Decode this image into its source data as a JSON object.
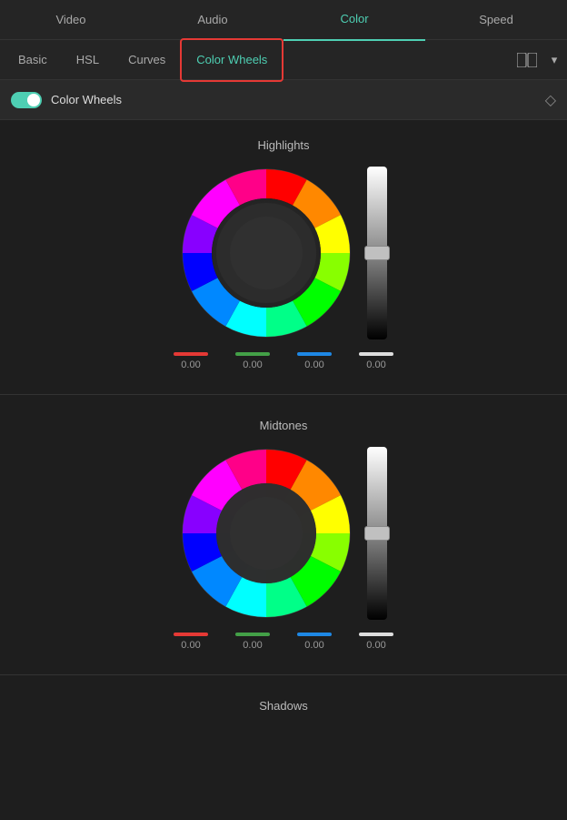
{
  "topTabs": {
    "tabs": [
      {
        "label": "Video",
        "active": false
      },
      {
        "label": "Audio",
        "active": false
      },
      {
        "label": "Color",
        "active": true
      },
      {
        "label": "Speed",
        "active": false
      }
    ]
  },
  "subTabs": {
    "tabs": [
      {
        "label": "Basic",
        "active": false
      },
      {
        "label": "HSL",
        "active": false
      },
      {
        "label": "Curves",
        "active": false
      },
      {
        "label": "Color Wheels",
        "active": true
      }
    ]
  },
  "sectionHeader": {
    "title": "Color Wheels",
    "toggleOn": true
  },
  "highlights": {
    "label": "Highlights",
    "red": "0.00",
    "green": "0.00",
    "blue": "0.00",
    "white": "0.00"
  },
  "midtones": {
    "label": "Midtones",
    "red": "0.00",
    "green": "0.00",
    "blue": "0.00",
    "white": "0.00"
  },
  "shadows": {
    "label": "Shadows"
  }
}
